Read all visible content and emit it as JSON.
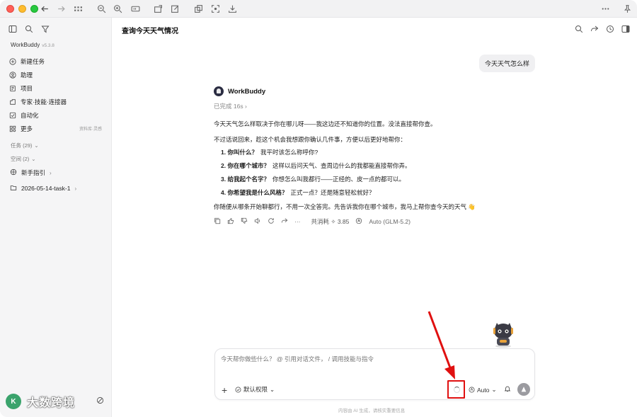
{
  "window": {
    "title": "查询今天天气情况"
  },
  "sidebar": {
    "brand": "WorkBuddy",
    "version": "v5.3.8",
    "nav": [
      {
        "label": "新建任务",
        "icon": "plus-circle-icon"
      },
      {
        "label": "助理",
        "icon": "assistant-icon"
      },
      {
        "label": "项目",
        "icon": "project-icon"
      },
      {
        "label": "专家·技能·连接器",
        "icon": "expert-icon"
      },
      {
        "label": "自动化",
        "icon": "automation-icon"
      },
      {
        "label": "更多",
        "icon": "more-grid-icon",
        "extra": "资料库·灵感"
      }
    ],
    "tasks_section": "任务 (29)",
    "space_section": "空间 (2)",
    "guide_item": "新手指引",
    "folder_item": "2026-05-14-task-1",
    "watermark": "大数跨境",
    "avatar_initial": "K"
  },
  "conversation": {
    "user_message": "今天天气怎么样",
    "bot_name": "WorkBuddy",
    "status": "已完成 16s",
    "para1": "今天天气怎么样取决于你在哪儿呀——我这边还不知道你的位置。没法直接帮你查。",
    "para2": "不过话说回来，趁这个机会我想跟你确认几件事，方便以后更好地帮你：",
    "questions": [
      {
        "num_title": "1. 你叫什么？",
        "text": "我平时该怎么称呼你?"
      },
      {
        "num_title": "2. 你在哪个城市？",
        "text": "这样以后问天气、查周边什么的我都能直接帮你弄。"
      },
      {
        "num_title": "3. 给我起个名字？",
        "text": "你想怎么叫我都行——正经的、皮一点的都可以。"
      },
      {
        "num_title": "4. 你希望我是什么风格？",
        "text": "正式一点？还是随意轻松就好？"
      }
    ],
    "para3": "你随便从哪条开始聊都行，不用一次全答完。先告诉我你在哪个城市，我马上帮你查今天的天气 👋",
    "usage": "共消耗 ✧ 3.85",
    "model": "Auto (GLM-5.2)"
  },
  "composer": {
    "placeholder": "今天帮你做些什么？ @ 引用对话文件， / 调用技能与指令",
    "permission": "默认权限",
    "mode": "Auto",
    "footer_note": "内容由 AI 生成，请核实重要信息"
  },
  "colors": {
    "accent_red": "#e01010",
    "send_button": "#9b9ba0"
  }
}
